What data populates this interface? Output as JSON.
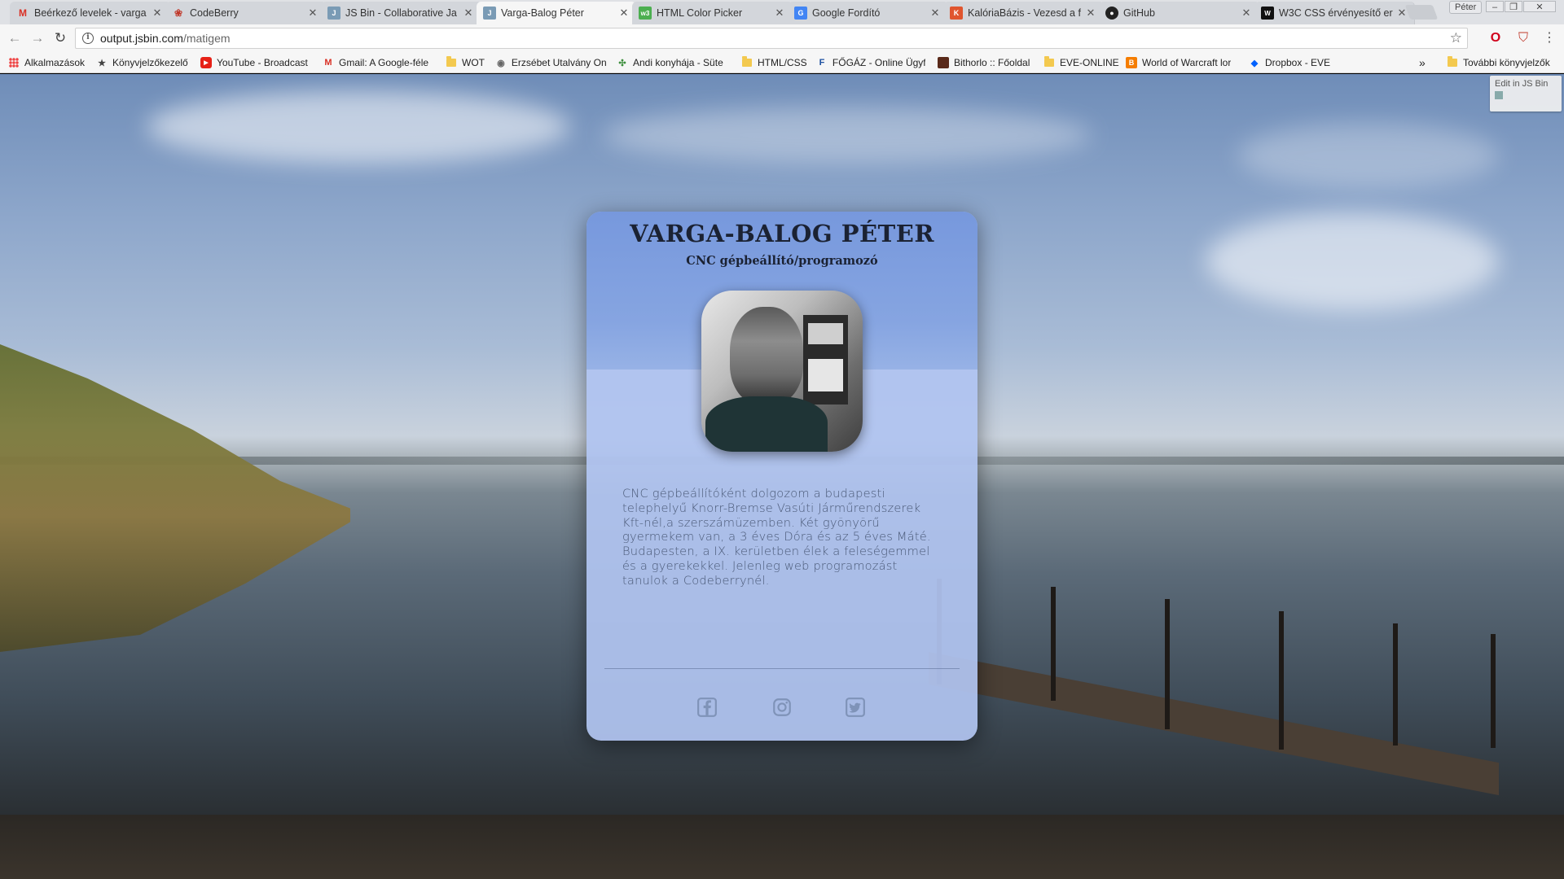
{
  "browser": {
    "tabs": [
      {
        "title": "Beérkező levelek - varga",
        "favicon": "gmail-icon",
        "active": false
      },
      {
        "title": "CodeBerry",
        "favicon": "codeberry-icon",
        "active": false
      },
      {
        "title": "JS Bin - Collaborative Ja",
        "favicon": "jsbin-icon",
        "active": false
      },
      {
        "title": "Varga-Balog Péter",
        "favicon": "jsbin-icon",
        "active": true
      },
      {
        "title": "HTML Color Picker",
        "favicon": "w3schools-icon",
        "active": false
      },
      {
        "title": "Google Fordító",
        "favicon": "google-translate-icon",
        "active": false
      },
      {
        "title": "KalóriaBázis - Vezesd a f",
        "favicon": "kaloriabazis-icon",
        "active": false
      },
      {
        "title": "GitHub",
        "favicon": "github-icon",
        "active": false
      },
      {
        "title": "W3C CSS érvényesítő er",
        "favicon": "w3c-icon",
        "active": false
      }
    ],
    "profile_label": "Péter",
    "url_host": "output.jsbin.com",
    "url_path": "/matigem"
  },
  "bookmarks": {
    "items": [
      {
        "label": "Alkalmazások",
        "icon": "apps-icon"
      },
      {
        "label": "Könyvjelzőkezelő",
        "icon": "star-icon"
      },
      {
        "label": "YouTube - Broadcast",
        "icon": "youtube-icon"
      },
      {
        "label": "Gmail: A Google-féle",
        "icon": "gmail-icon"
      },
      {
        "label": "WOT",
        "icon": "folder-icon"
      },
      {
        "label": "Erzsébet Utalvány On",
        "icon": "erzsebet-icon"
      },
      {
        "label": "Andi konyhája - Süte",
        "icon": "andi-icon"
      },
      {
        "label": "HTML/CSS",
        "icon": "folder-icon"
      },
      {
        "label": "FŐGÁZ - Online Ügyf",
        "icon": "fogaz-icon"
      },
      {
        "label": "Bithorlo :: Főoldal",
        "icon": "bithorlo-icon"
      },
      {
        "label": "EVE-ONLINE",
        "icon": "folder-icon"
      },
      {
        "label": "World of Warcraft lor",
        "icon": "blogger-icon"
      },
      {
        "label": "Dropbox - EVE",
        "icon": "dropbox-icon"
      }
    ],
    "more_label": "»",
    "other_label": "További könyvjelzők"
  },
  "page": {
    "edit_label": "Edit in JS Bin",
    "card": {
      "name": "VARGA-BALOG PÉTER",
      "role": "CNC gépbeállító/programozó",
      "bio": "CNC gépbeállítóként dolgozom a budapesti telephelyű Knorr-Bremse Vasúti Járműrendszerek Kft-nél,a szerszámüzemben. Két gyönyörű gyermekem van, a 3 éves Dóra és az 5 éves Máté. Budapesten, a IX. kerületben élek a feleségemmel és a gyerekekkel. Jelenleg web programozást tanulok a Codeberrynél.",
      "social": [
        "facebook-icon",
        "instagram-icon",
        "twitter-icon"
      ]
    }
  }
}
